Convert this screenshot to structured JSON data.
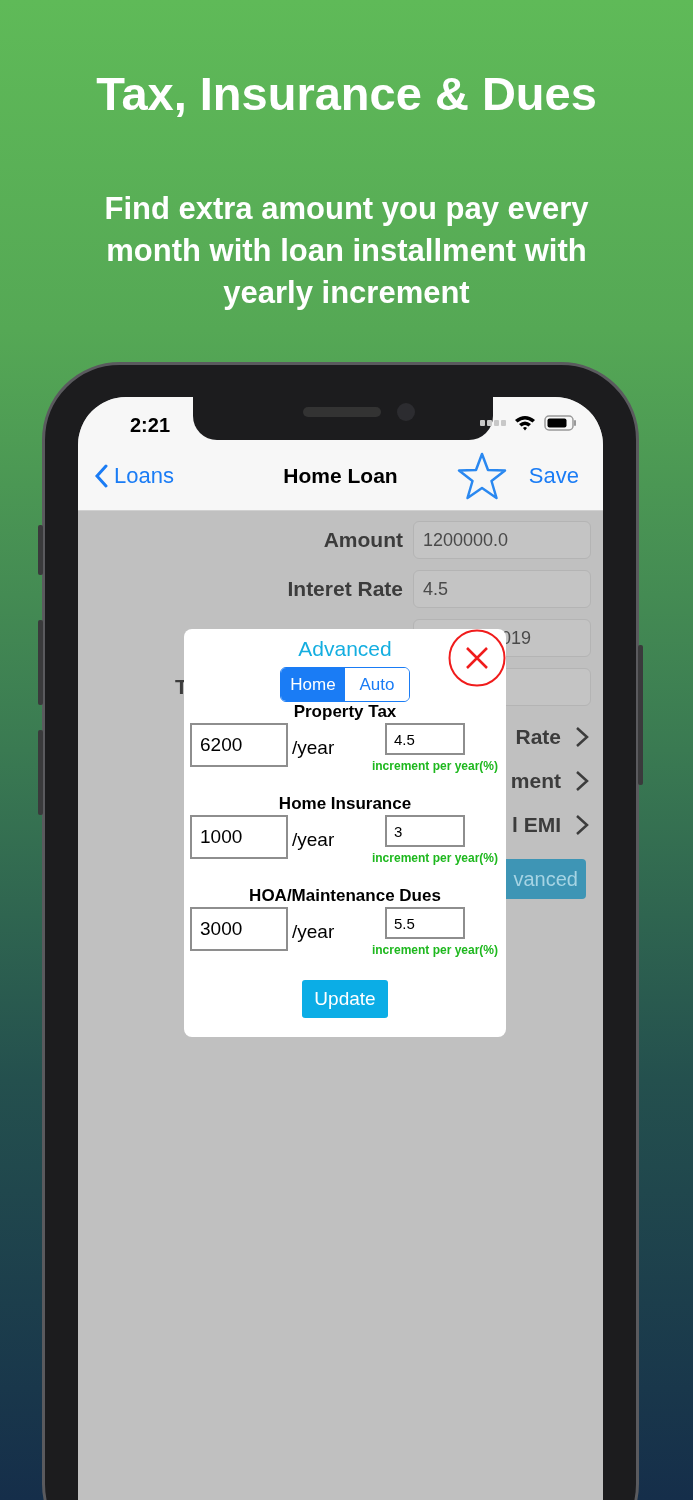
{
  "headline": "Tax, Insurance & Dues",
  "subheadline": "Find extra amount you pay every month with loan installment with yearly increment",
  "status_bar": {
    "time": "2:21"
  },
  "nav": {
    "back": "Loans",
    "title": "Home Loan",
    "action": "Save"
  },
  "form": {
    "fields": [
      {
        "label": "Amount",
        "value": "1200000.0"
      },
      {
        "label": "Interet Rate",
        "value": "4.5"
      },
      {
        "value": "019"
      },
      {
        "label": "T"
      }
    ],
    "links": [
      "Rate",
      "ment",
      "l EMI"
    ],
    "button": "vanced"
  },
  "modal": {
    "title": "Advanced",
    "tabs": [
      {
        "label": "Home",
        "selected": true
      },
      {
        "label": "Auto",
        "selected": false
      }
    ],
    "sections": [
      {
        "title": "Property Tax",
        "amount": "6200",
        "unit": "/year",
        "increment": "4.5",
        "caption": "increment per year(%)"
      },
      {
        "title": "Home Insurance",
        "amount": "1000",
        "unit": "/year",
        "increment": "3",
        "caption": "increment per year(%)"
      },
      {
        "title": "HOA/Maintenance Dues",
        "amount": "3000",
        "unit": "/year",
        "increment": "5.5",
        "caption": "increment per year(%)"
      }
    ],
    "button": "Update"
  }
}
